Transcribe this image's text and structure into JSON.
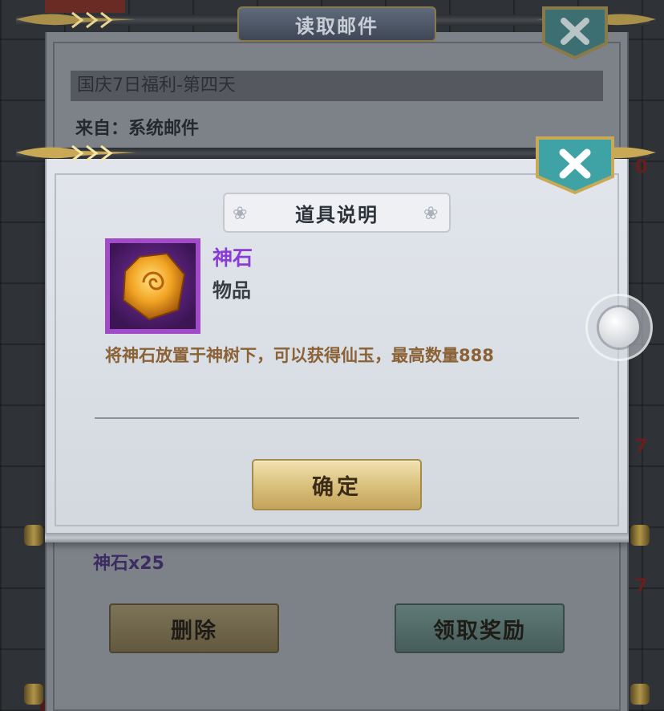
{
  "mail_dialog": {
    "title": "读取邮件",
    "subject": "国庆7日福利-第四天",
    "from": "来自：系统邮件",
    "reward": "神石x25",
    "delete_label": "删除",
    "claim_label": "领取奖励"
  },
  "item_dialog": {
    "header": "道具说明",
    "item_name": "神石",
    "item_type": "物品",
    "description": "将神石放置于神树下，可以获得仙玉，最高数量888",
    "confirm_label": "确定"
  },
  "background": {
    "red_digits": [
      "0",
      "7",
      "7"
    ]
  },
  "icons": {
    "close": "close-icon",
    "item": "divine-stone-icon",
    "floating": "floating-joystick-icon"
  },
  "colors": {
    "item_name_purple": "#8a3cd6",
    "description_brown": "#8a6236",
    "confirm_gold": "#d8bf7a",
    "close_teal": "#3fa3a6"
  }
}
